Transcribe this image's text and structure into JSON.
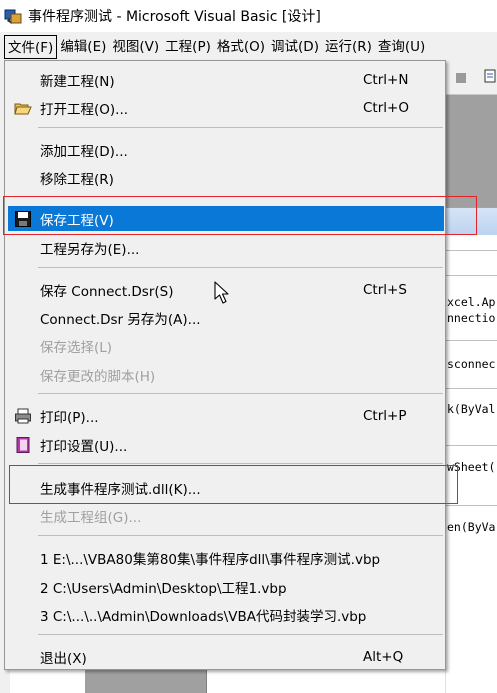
{
  "window": {
    "title": "事件程序测试 - Microsoft Visual Basic [设计]"
  },
  "menubar": [
    {
      "label": "文件(F)"
    },
    {
      "label": "编辑(E)"
    },
    {
      "label": "视图(V)"
    },
    {
      "label": "工程(P)"
    },
    {
      "label": "格式(O)"
    },
    {
      "label": "调试(D)"
    },
    {
      "label": "运行(R)"
    },
    {
      "label": "查询(U)"
    }
  ],
  "file_menu": {
    "new_project": "新建工程(N)",
    "new_project_sc": "Ctrl+N",
    "open_project": "打开工程(O)...",
    "open_project_sc": "Ctrl+O",
    "add_project": "添加工程(D)...",
    "remove_project": "移除工程(R)",
    "save_project": "保存工程(V)",
    "save_project_as": "工程另存为(E)...",
    "save_connect": "保存 Connect.Dsr(S)",
    "save_connect_sc": "Ctrl+S",
    "connect_save_as": "Connect.Dsr 另存为(A)...",
    "save_selection": "保存选择(L)",
    "save_changed_script": "保存更改的脚本(H)",
    "print": "打印(P)...",
    "print_sc": "Ctrl+P",
    "print_setup": "打印设置(U)...",
    "make_dll": "生成事件程序测试.dll(K)...",
    "make_group": "生成工程组(G)...",
    "recent1": "1 E:\\...\\VBA80集第80集\\事件程序dll\\事件程序测试.vbp",
    "recent2": "2 C:\\Users\\Admin\\Desktop\\工程1.vbp",
    "recent3": "3 C:\\...\\..\\Admin\\Downloads\\VBA代码封装学习.vbp",
    "exit": "退出(X)",
    "exit_sc": "Alt+Q"
  },
  "code_fragments": [
    "xcel.Ap",
    "nnectio",
    "sconnec",
    "k(ByVal",
    "wSheet(",
    "en(ByVa"
  ],
  "colors": {
    "highlight": "#0a78d7",
    "annotation": "#e0242a",
    "menu_bg": "#f0f0f0"
  }
}
